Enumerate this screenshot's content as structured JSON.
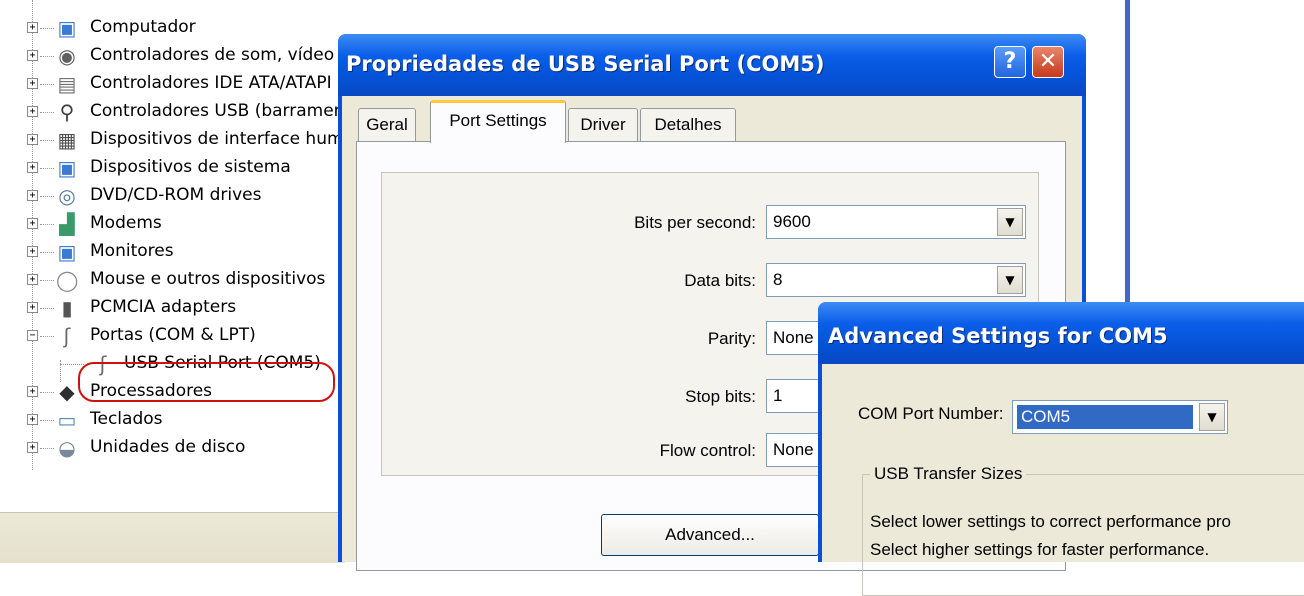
{
  "device_tree": {
    "items": [
      {
        "label": "Computador",
        "icon": "computer-icon",
        "expander": "+"
      },
      {
        "label": "Controladores de som, vídeo",
        "icon": "sound-icon",
        "expander": "+"
      },
      {
        "label": "Controladores IDE ATA/ATAPI",
        "icon": "ide-icon",
        "expander": "+"
      },
      {
        "label": "Controladores USB (barramento",
        "icon": "usb-icon",
        "expander": "+"
      },
      {
        "label": "Dispositivos de interface humana",
        "icon": "hid-icon",
        "expander": "+"
      },
      {
        "label": "Dispositivos de sistema",
        "icon": "system-icon",
        "expander": "+"
      },
      {
        "label": "DVD/CD-ROM drives",
        "icon": "dvd-icon",
        "expander": "+"
      },
      {
        "label": "Modems",
        "icon": "modem-icon",
        "expander": "+"
      },
      {
        "label": "Monitores",
        "icon": "monitor-icon",
        "expander": "+"
      },
      {
        "label": "Mouse e outros dispositivos",
        "icon": "mouse-icon",
        "expander": "+"
      },
      {
        "label": "PCMCIA adapters",
        "icon": "pcmcia-icon",
        "expander": "+"
      },
      {
        "label": "Portas (COM & LPT)",
        "icon": "port-icon",
        "expander": "−"
      },
      {
        "label": "USB Serial Port (COM5)",
        "icon": "port-icon",
        "expander": ""
      },
      {
        "label": "Processadores",
        "icon": "processor-icon",
        "expander": "+"
      },
      {
        "label": "Teclados",
        "icon": "keyboard-icon",
        "expander": "+"
      },
      {
        "label": "Unidades de disco",
        "icon": "disk-icon",
        "expander": "+"
      }
    ]
  },
  "properties_dialog": {
    "title": "Propriedades de USB Serial Port (COM5)",
    "help_glyph": "?",
    "close_glyph": "✕",
    "tabs": [
      "Geral",
      "Port Settings",
      "Driver",
      "Detalhes"
    ],
    "active_tab": "Port Settings",
    "fields": {
      "bits_per_second": {
        "label": "Bits per second:",
        "value": "9600"
      },
      "data_bits": {
        "label": "Data bits:",
        "value": "8"
      },
      "parity": {
        "label": "Parity:",
        "value": "None"
      },
      "stop_bits": {
        "label": "Stop bits:",
        "value": "1"
      },
      "flow_control": {
        "label": "Flow control:",
        "value": "None"
      }
    },
    "advanced_button": "Advanced..."
  },
  "advanced_dialog": {
    "title": "Advanced Settings for COM5",
    "com_port_label": "COM Port Number:",
    "com_port_value": "COM5",
    "usb_transfer_legend": "USB Transfer Sizes",
    "note_lower": "Select lower settings to correct performance pro",
    "note_higher": "Select higher settings for faster performance."
  },
  "colors": {
    "title_bar": "#0a5ee8",
    "dialog_face": "#ece9d8",
    "highlight_ring": "#d01010",
    "selection": "#316ac5"
  }
}
